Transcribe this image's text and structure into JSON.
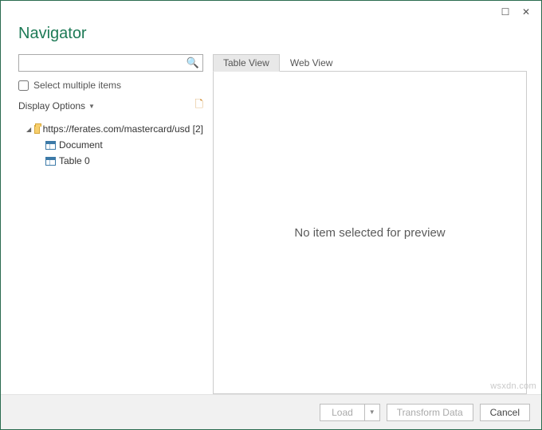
{
  "titlebar": {
    "maximize_glyph": "☐",
    "close_glyph": "✕"
  },
  "header": {
    "title": "Navigator"
  },
  "search": {
    "placeholder": ""
  },
  "options": {
    "select_multiple_label": "Select multiple items",
    "display_options_label": "Display Options"
  },
  "tree": {
    "root_label": "https://ferates.com/mastercard/usd [2]",
    "children": [
      {
        "label": "Document"
      },
      {
        "label": "Table 0"
      }
    ]
  },
  "tabs": {
    "table_view": "Table View",
    "web_view": "Web View"
  },
  "preview": {
    "empty_message": "No item selected for preview"
  },
  "footer": {
    "load_label": "Load",
    "transform_label": "Transform Data",
    "cancel_label": "Cancel"
  },
  "watermark": "wsxdn.com"
}
